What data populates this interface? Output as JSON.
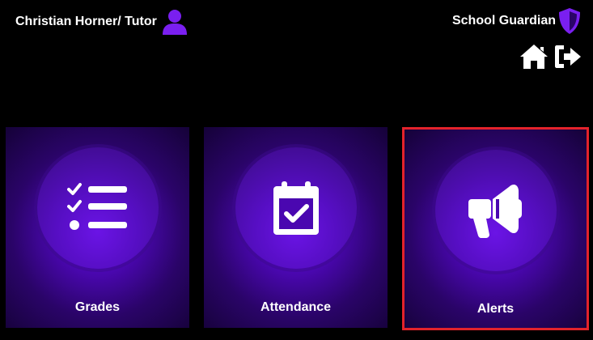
{
  "header": {
    "user_name": "Christian Horner/ Tutor",
    "user_icon": "user-icon",
    "brand_name": "School Guardian",
    "brand_icon": "shield-icon",
    "nav": [
      {
        "icon": "home-icon"
      },
      {
        "icon": "logout-icon"
      }
    ]
  },
  "tiles": [
    {
      "label": "Grades",
      "icon": "checklist-icon"
    },
    {
      "label": "Attendance",
      "icon": "calendar-check-icon"
    },
    {
      "label": "Alerts",
      "icon": "megaphone-icon",
      "selected": true
    }
  ],
  "colors": {
    "background": "#000000",
    "accent": "#7a1ff0",
    "tile_center": "#6a10e6",
    "tile_edge": "#150238",
    "selection": "#e3232b",
    "text": "#ffffff"
  }
}
